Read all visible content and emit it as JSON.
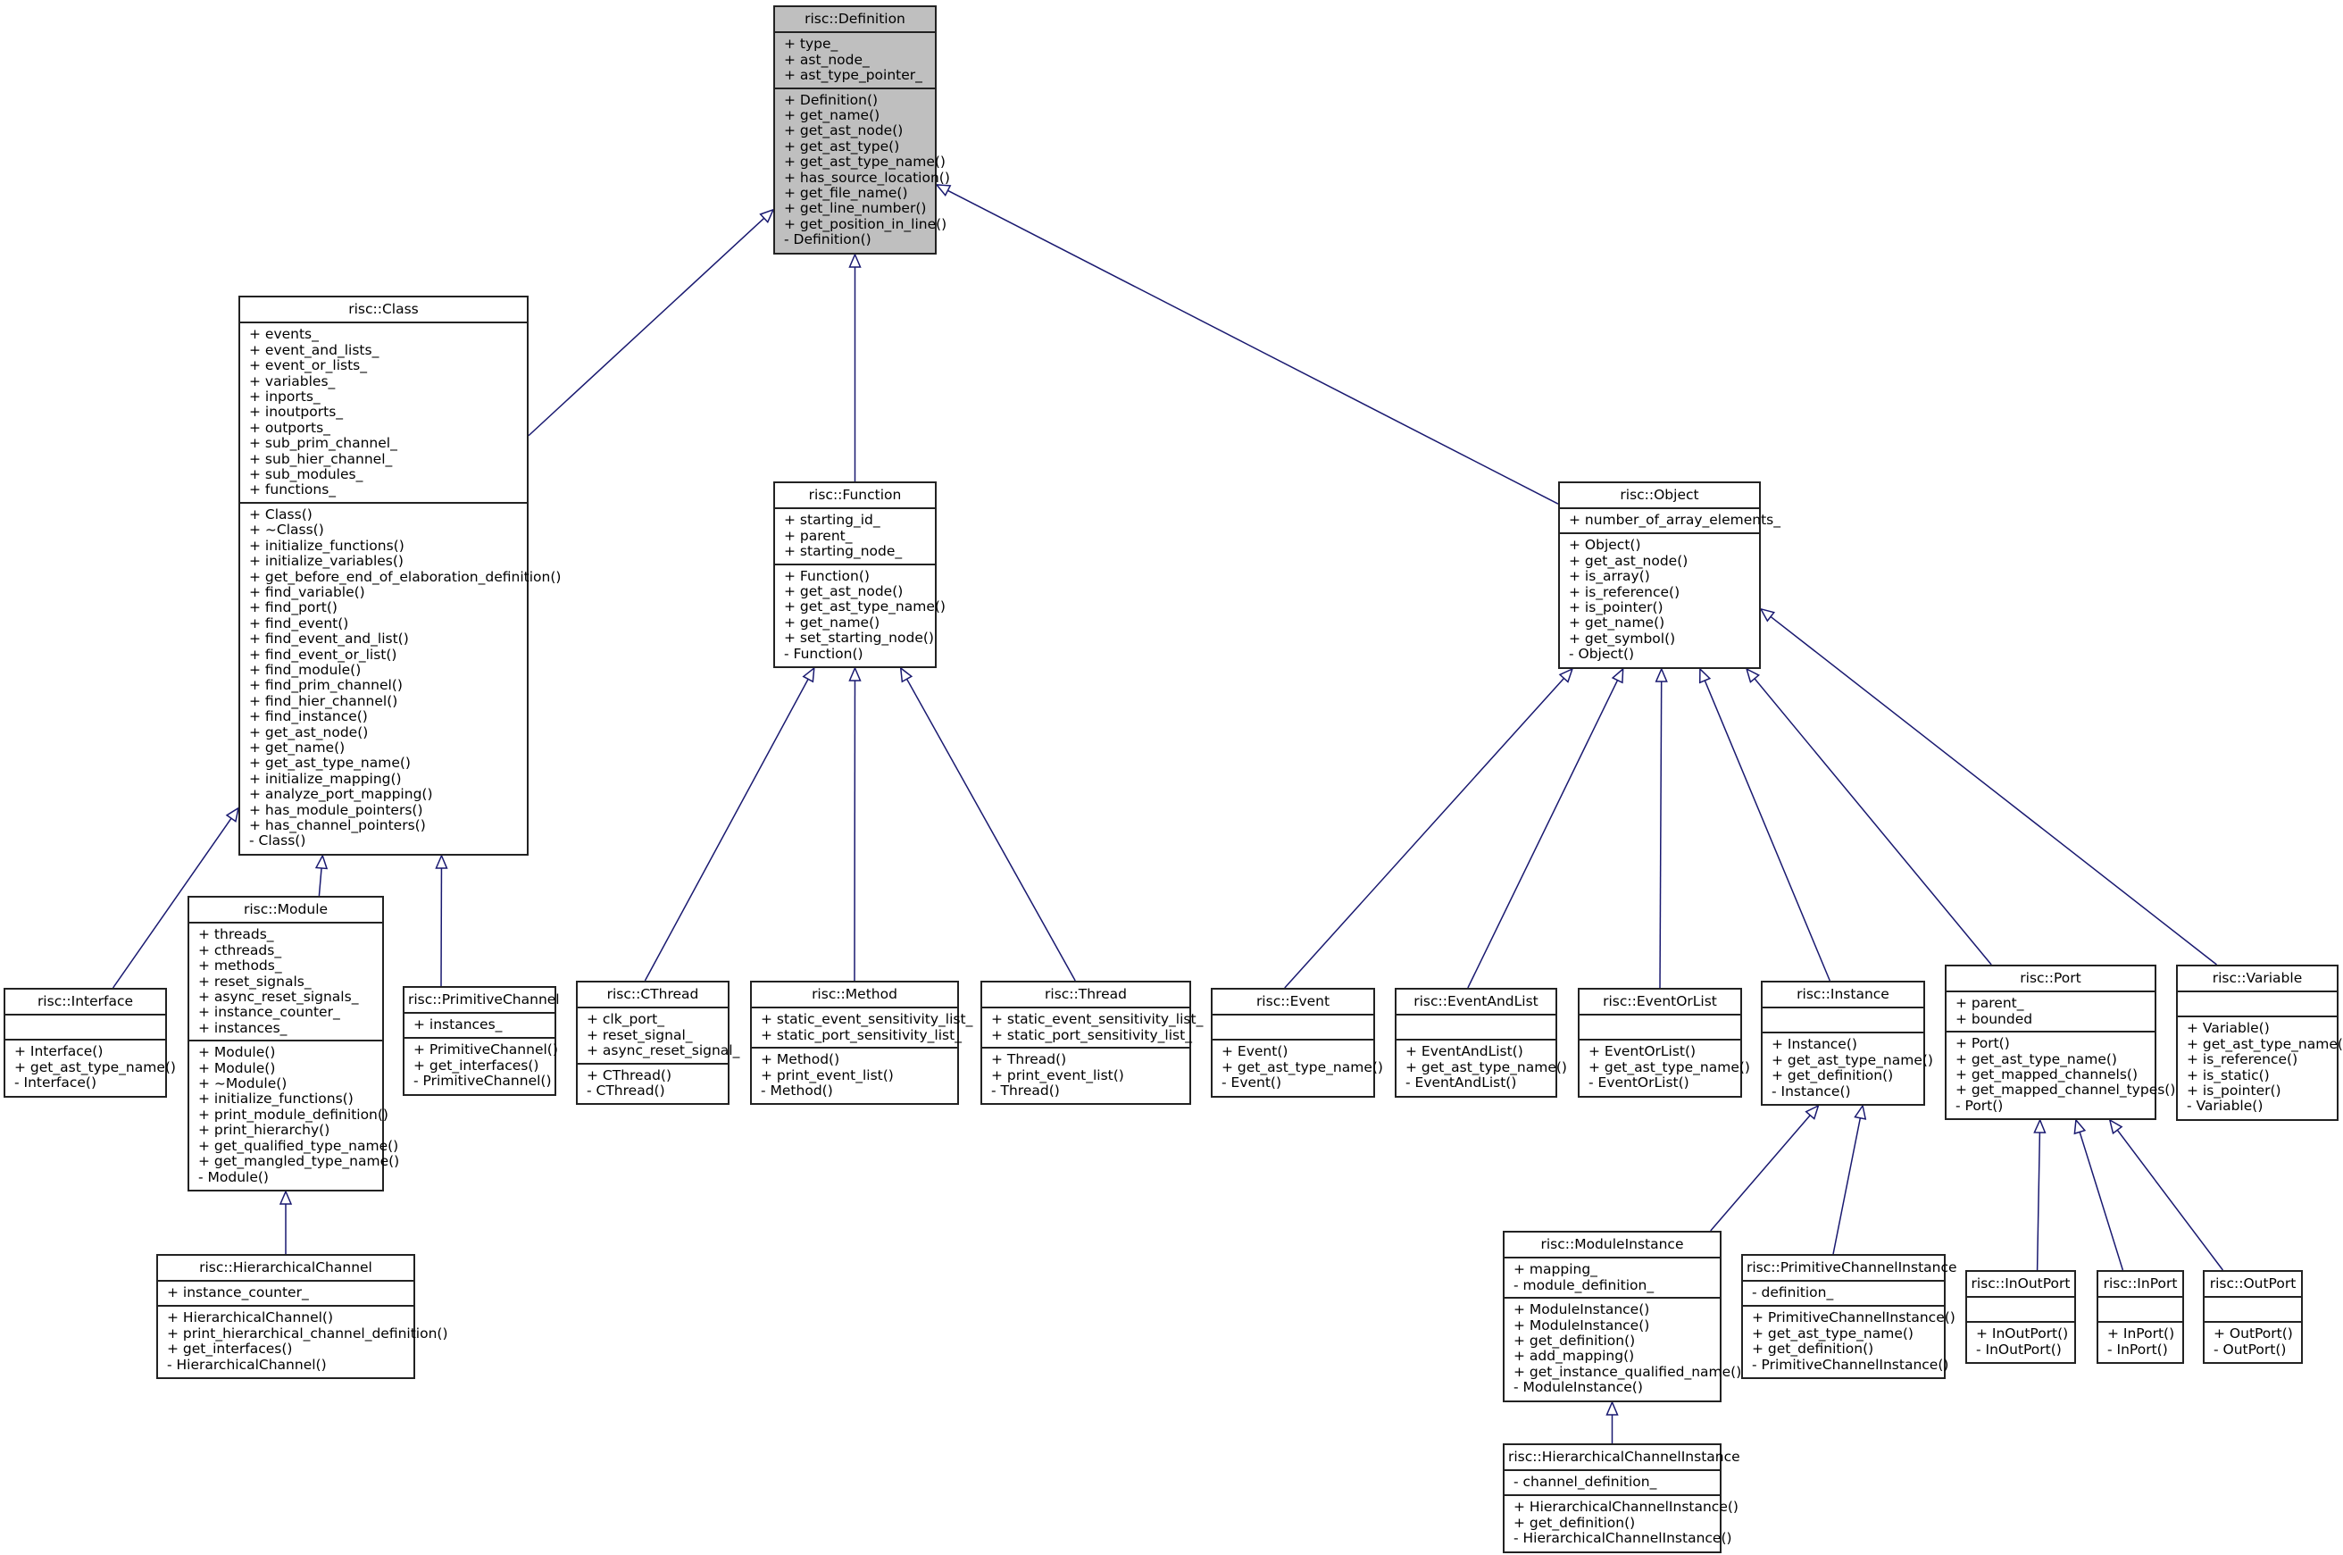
{
  "diagram": {
    "type": "uml-class-inheritance",
    "edge_color": "#191970",
    "root_fill": "#bfbfbf",
    "classes": [
      {
        "id": "definition",
        "name": "risc::Definition",
        "root": true,
        "attributes": [
          "+ type_",
          "+ ast_node_",
          "+ ast_type_pointer_"
        ],
        "operations": [
          "+ Definition()",
          "+ get_name()",
          "+ get_ast_node()",
          "+ get_ast_type()",
          "+ get_ast_type_name()",
          "+ has_source_location()",
          "+ get_file_name()",
          "+ get_line_number()",
          "+ get_position_in_line()",
          "- Definition()"
        ]
      },
      {
        "id": "class",
        "name": "risc::Class",
        "parent": "definition",
        "attributes": [
          "+ events_",
          "+ event_and_lists_",
          "+ event_or_lists_",
          "+ variables_",
          "+ inports_",
          "+ inoutports_",
          "+ outports_",
          "+ sub_prim_channel_",
          "+ sub_hier_channel_",
          "+ sub_modules_",
          "+ functions_"
        ],
        "operations": [
          "+ Class()",
          "+ ~Class()",
          "+ initialize_functions()",
          "+ initialize_variables()",
          "+ get_before_end_of_elaboration_definition()",
          "+ find_variable()",
          "+ find_port()",
          "+ find_event()",
          "+ find_event_and_list()",
          "+ find_event_or_list()",
          "+ find_module()",
          "+ find_prim_channel()",
          "+ find_hier_channel()",
          "+ find_instance()",
          "+ get_ast_node()",
          "+ get_name()",
          "+ get_ast_type_name()",
          "+ initialize_mapping()",
          "+ analyze_port_mapping()",
          "+ has_module_pointers()",
          "+ has_channel_pointers()",
          "- Class()"
        ]
      },
      {
        "id": "function",
        "name": "risc::Function",
        "parent": "definition",
        "attributes": [
          "+ starting_id_",
          "+ parent_",
          "+ starting_node_"
        ],
        "operations": [
          "+ Function()",
          "+ get_ast_node()",
          "+ get_ast_type_name()",
          "+ get_name()",
          "+ set_starting_node()",
          "- Function()"
        ]
      },
      {
        "id": "object",
        "name": "risc::Object",
        "parent": "definition",
        "attributes": [
          "+ number_of_array_elements_"
        ],
        "operations": [
          "+ Object()",
          "+ get_ast_node()",
          "+ is_array()",
          "+ is_reference()",
          "+ is_pointer()",
          "+ get_name()",
          "+ get_symbol()",
          "- Object()"
        ]
      },
      {
        "id": "interface",
        "name": "risc::Interface",
        "parent": "class",
        "attributes": [],
        "operations": [
          "+ Interface()",
          "+ get_ast_type_name()",
          "- Interface()"
        ]
      },
      {
        "id": "module",
        "name": "risc::Module",
        "parent": "class",
        "attributes": [
          "+ threads_",
          "+ cthreads_",
          "+ methods_",
          "+ reset_signals_",
          "+ async_reset_signals_",
          "+ instance_counter_",
          "+ instances_"
        ],
        "operations": [
          "+ Module()",
          "+ Module()",
          "+ ~Module()",
          "+ initialize_functions()",
          "+ print_module_definition()",
          "+ print_hierarchy()",
          "+ get_qualified_type_name()",
          "+ get_mangled_type_name()",
          "- Module()"
        ]
      },
      {
        "id": "primitivechannel",
        "name": "risc::PrimitiveChannel",
        "parent": "class",
        "attributes": [
          "+ instances_"
        ],
        "operations": [
          "+ PrimitiveChannel()",
          "+ get_interfaces()",
          "- PrimitiveChannel()"
        ]
      },
      {
        "id": "hierarchicalchannel",
        "name": "risc::HierarchicalChannel",
        "parent": "module",
        "attributes": [
          "+ instance_counter_"
        ],
        "operations": [
          "+ HierarchicalChannel()",
          "+ print_hierarchical_channel_definition()",
          "+ get_interfaces()",
          "- HierarchicalChannel()"
        ]
      },
      {
        "id": "cthread",
        "name": "risc::CThread",
        "parent": "function",
        "attributes": [
          "+ clk_port_",
          "+ reset_signal_",
          "+ async_reset_signal_"
        ],
        "operations": [
          "+ CThread()",
          "- CThread()"
        ]
      },
      {
        "id": "method",
        "name": "risc::Method",
        "parent": "function",
        "attributes": [
          "+ static_event_sensitivity_list_",
          "+ static_port_sensitivity_list_"
        ],
        "operations": [
          "+ Method()",
          "+ print_event_list()",
          "- Method()"
        ]
      },
      {
        "id": "thread",
        "name": "risc::Thread",
        "parent": "function",
        "attributes": [
          "+ static_event_sensitivity_list_",
          "+ static_port_sensitivity_list_"
        ],
        "operations": [
          "+ Thread()",
          "+ print_event_list()",
          "- Thread()"
        ]
      },
      {
        "id": "event",
        "name": "risc::Event",
        "parent": "object",
        "attributes": [],
        "operations": [
          "+ Event()",
          "+ get_ast_type_name()",
          "- Event()"
        ]
      },
      {
        "id": "eventandlist",
        "name": "risc::EventAndList",
        "parent": "object",
        "attributes": [],
        "operations": [
          "+ EventAndList()",
          "+ get_ast_type_name()",
          "- EventAndList()"
        ]
      },
      {
        "id": "eventorlist",
        "name": "risc::EventOrList",
        "parent": "object",
        "attributes": [],
        "operations": [
          "+ EventOrList()",
          "+ get_ast_type_name()",
          "- EventOrList()"
        ]
      },
      {
        "id": "instance",
        "name": "risc::Instance",
        "parent": "object",
        "attributes": [],
        "operations": [
          "+ Instance()",
          "+ get_ast_type_name()",
          "+ get_definition()",
          "- Instance()"
        ]
      },
      {
        "id": "port",
        "name": "risc::Port",
        "parent": "object",
        "attributes": [
          "+ parent_",
          "+ bounded"
        ],
        "operations": [
          "+ Port()",
          "+ get_ast_type_name()",
          "+ get_mapped_channels()",
          "+ get_mapped_channel_types()",
          "- Port()"
        ]
      },
      {
        "id": "variable",
        "name": "risc::Variable",
        "parent": "object",
        "attributes": [],
        "operations": [
          "+ Variable()",
          "+ get_ast_type_name()",
          "+ is_reference()",
          "+ is_static()",
          "+ is_pointer()",
          "- Variable()"
        ]
      },
      {
        "id": "moduleinstance",
        "name": "risc::ModuleInstance",
        "parent": "instance",
        "attributes": [
          "+ mapping_",
          "- module_definition_"
        ],
        "operations": [
          "+ ModuleInstance()",
          "+ ModuleInstance()",
          "+ get_definition()",
          "+ add_mapping()",
          "+ get_instance_qualified_name()",
          "- ModuleInstance()"
        ]
      },
      {
        "id": "primitivechannelinstance",
        "name": "risc::PrimitiveChannelInstance",
        "parent": "instance",
        "attributes": [
          "- definition_"
        ],
        "operations": [
          "+ PrimitiveChannelInstance()",
          "+ get_ast_type_name()",
          "+ get_definition()",
          "- PrimitiveChannelInstance()"
        ]
      },
      {
        "id": "hierarchicalchannelinstance",
        "name": "risc::HierarchicalChannelInstance",
        "parent": "moduleinstance",
        "attributes": [
          "- channel_definition_"
        ],
        "operations": [
          "+ HierarchicalChannelInstance()",
          "+ get_definition()",
          "- HierarchicalChannelInstance()"
        ]
      },
      {
        "id": "inoutport",
        "name": "risc::InOutPort",
        "parent": "port",
        "attributes": [],
        "operations": [
          "+ InOutPort()",
          "- InOutPort()"
        ]
      },
      {
        "id": "inport",
        "name": "risc::InPort",
        "parent": "port",
        "attributes": [],
        "operations": [
          "+ InPort()",
          "- InPort()"
        ]
      },
      {
        "id": "outport",
        "name": "risc::OutPort",
        "parent": "port",
        "attributes": [],
        "operations": [
          "+ OutPort()",
          "- OutPort()"
        ]
      }
    ]
  }
}
